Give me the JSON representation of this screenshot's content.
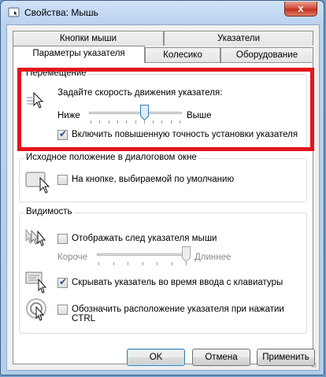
{
  "window": {
    "title": "Свойства: Мышь",
    "close_symbol": "x"
  },
  "tabs": {
    "row_back": [
      "Кнопки мыши",
      "Указатели"
    ],
    "row_front": [
      "Параметры указателя",
      "Колесико",
      "Оборудование"
    ],
    "active": "Параметры указателя"
  },
  "motion": {
    "group_label": "Перемещение",
    "speed_label": "Задайте скорость движения указателя:",
    "slow_label": "Ниже",
    "fast_label": "Выше",
    "speed_level": 0.6,
    "precision_label": "Включить повышенную точность установки указателя",
    "precision_checked": true
  },
  "snap": {
    "group_label": "Исходное положение в диалоговом окне",
    "label": "На кнопке, выбираемой по умолчанию",
    "checked": false
  },
  "visibility": {
    "group_label": "Видимость",
    "trails_label": "Отображать след указателя мыши",
    "trails_checked": false,
    "short_label": "Короче",
    "long_label": "Длиннее",
    "trails_level": 1.0,
    "hide_label": "Скрывать указатель во время ввода с клавиатуры",
    "hide_checked": true,
    "ctrl_label_line1": "Обозначить расположение указателя при нажатии",
    "ctrl_label_line2": "CTRL",
    "ctrl_checked": false
  },
  "buttons": {
    "ok": "OK",
    "cancel": "Отмена",
    "apply": "Применить"
  },
  "colors": {
    "highlight": "#e3141c",
    "close_button": "#c2321f",
    "check_tick": "#2b4c8a"
  },
  "icons": {
    "check": "✔"
  }
}
